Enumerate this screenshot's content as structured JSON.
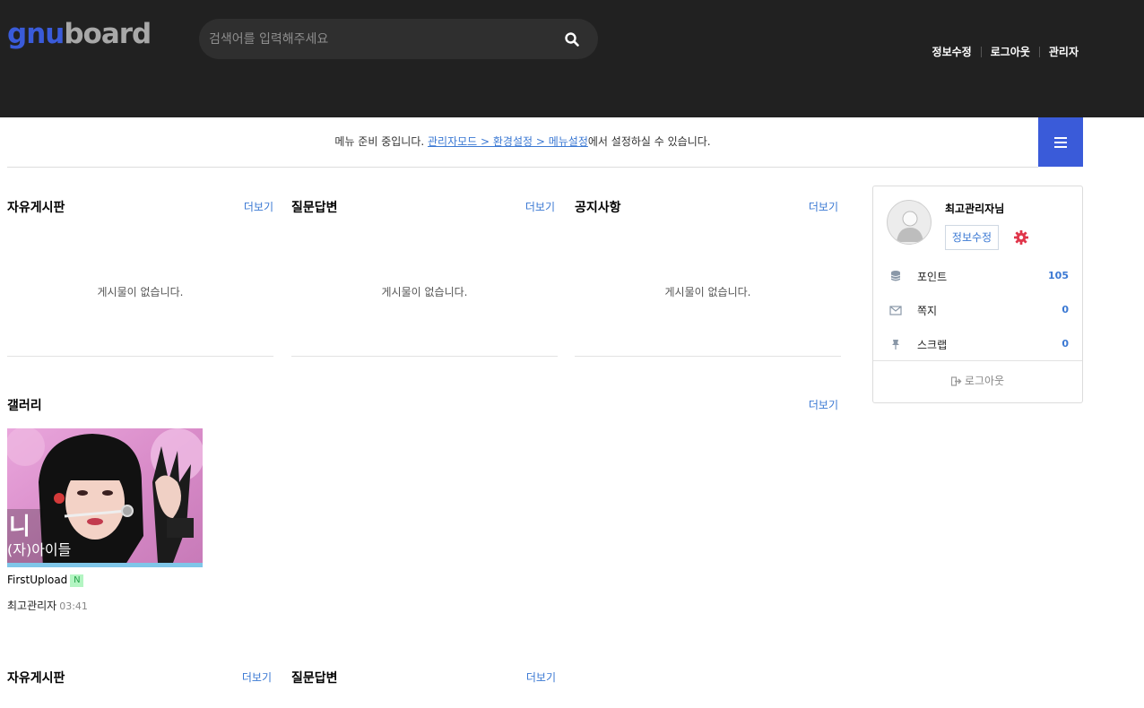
{
  "header": {
    "logo_a": "gnu",
    "logo_b": "board",
    "search_placeholder": "검색어를 입력해주세요",
    "links": [
      "정보수정",
      "로그아웃",
      "관리자"
    ]
  },
  "menubar": {
    "text_before": "메뉴 준비 중입니다. ",
    "link_text": "관리자모드 > 환경설정 > 메뉴설정",
    "text_after": "에서 설정하실 수 있습니다."
  },
  "boards_row1": [
    {
      "title": "자유게시판",
      "more": "더보기",
      "empty": "게시물이 없습니다."
    },
    {
      "title": "질문답변",
      "more": "더보기",
      "empty": "게시물이 없습니다."
    },
    {
      "title": "공지사항",
      "more": "더보기",
      "empty": "게시물이 없습니다."
    }
  ],
  "gallery": {
    "title": "갤러리",
    "more": "더보기",
    "item": {
      "title": "FirstUpload",
      "badge": "N",
      "author": "최고관리자",
      "time": "03:41",
      "thumb_caption": "(자)아이들"
    }
  },
  "boards_row2": [
    {
      "title": "자유게시판",
      "more": "더보기"
    },
    {
      "title": "질문답변",
      "more": "더보기"
    }
  ],
  "profile": {
    "name": "최고관리자님",
    "edit": "정보수정",
    "rows": [
      {
        "label": "포인트",
        "value": "105",
        "icon": "database-icon"
      },
      {
        "label": "쪽지",
        "value": "0",
        "icon": "envelope-icon"
      },
      {
        "label": "스크랩",
        "value": "0",
        "icon": "pin-icon"
      }
    ],
    "logout": "로그아웃"
  },
  "colors": {
    "header_bg": "#212121",
    "accent": "#3a5bd9",
    "link": "#3a78d3"
  }
}
